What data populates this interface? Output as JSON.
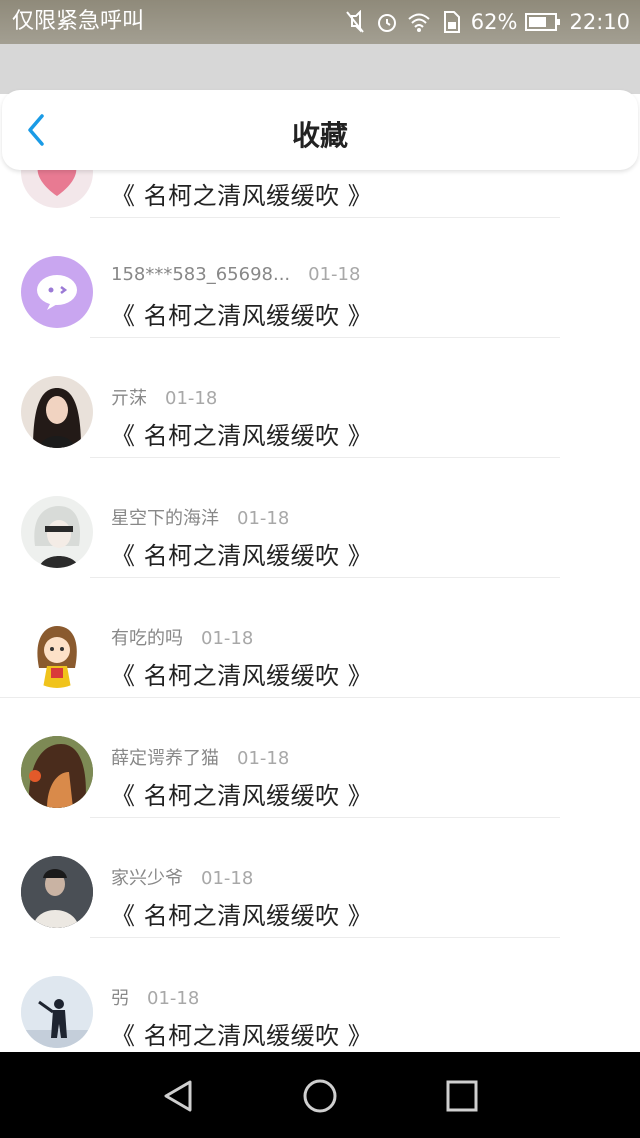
{
  "status_bar": {
    "carrier": "仅限紧急呼叫",
    "battery": "62%",
    "time": "22:10",
    "icons": [
      "mute-icon",
      "alarm-icon",
      "wifi-icon",
      "sim-icon",
      "battery-icon"
    ]
  },
  "header": {
    "title": "收藏",
    "back_icon": "chevron-left-icon"
  },
  "list": {
    "items": [
      {
        "name": "",
        "date": "",
        "message": "《 名柯之清风缓缓吹 》",
        "avatar": "heart-avatar"
      },
      {
        "name": "158***583_65698...",
        "date": "01-18",
        "message": "《 名柯之清风缓缓吹 》",
        "avatar": "chat-bubble-avatar"
      },
      {
        "name": "亓莯",
        "date": "01-18",
        "message": "《 名柯之清风缓缓吹 》",
        "avatar": "woman-photo-avatar"
      },
      {
        "name": "星空下的海洋",
        "date": "01-18",
        "message": "《 名柯之清风缓缓吹 》",
        "avatar": "anime-character-avatar"
      },
      {
        "name": "有吃的吗",
        "date": "01-18",
        "message": "《 名柯之清风缓缓吹 》",
        "avatar": "cartoon-girl-avatar"
      },
      {
        "name": "薛定谔养了猫",
        "date": "01-18",
        "message": "《 名柯之清风缓缓吹 》",
        "avatar": "girl-hair-avatar"
      },
      {
        "name": "家兴少爷",
        "date": "01-18",
        "message": "《 名柯之清风缓缓吹 》",
        "avatar": "boy-photo-avatar"
      },
      {
        "name": "弜",
        "date": "01-18",
        "message": "《 名柯之清风缓缓吹 》",
        "avatar": "silhouette-avatar"
      }
    ]
  },
  "nav_bar": {
    "buttons": [
      "back-triangle-icon",
      "home-circle-icon",
      "recents-square-icon"
    ]
  },
  "colors": {
    "accent": "#1a9be6",
    "avatar_purple": "#c9a6f0"
  }
}
